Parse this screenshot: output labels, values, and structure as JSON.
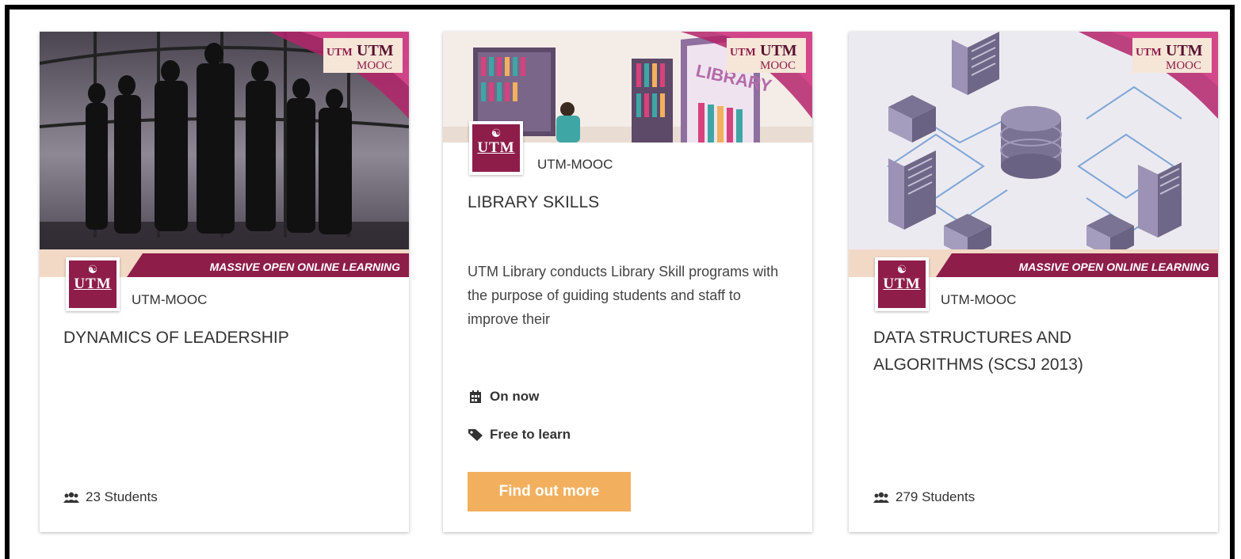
{
  "courses": [
    {
      "provider": "UTM-MOOC",
      "logo_text": "UTM",
      "banner": "MASSIVE OPEN ONLINE LEARNING",
      "brand": "UTM MOOC",
      "title": "DYNAMICS OF LEADERSHIP",
      "students": "23 Students",
      "icon": "users-icon"
    },
    {
      "provider": "UTM-MOOC",
      "logo_text": "UTM",
      "brand": "UTM MOOC",
      "hero_sign": "LIBRARY",
      "title": "LIBRARY SKILLS",
      "description": "UTM Library conducts Library Skill programs with the purpose of guiding students and staff to improve their",
      "availability": "On now",
      "price": "Free to learn",
      "button_label": "Find out more"
    },
    {
      "provider": "UTM-MOOC",
      "logo_text": "UTM",
      "banner": "MASSIVE OPEN ONLINE LEARNING",
      "brand": "UTM MOOC",
      "title": "DATA STRUCTURES AND ALGORITHMS (SCSJ 2013)",
      "students": "279 Students",
      "icon": "users-icon"
    }
  ],
  "colors": {
    "brand": "#8e1d4a",
    "accent": "#f2b05e",
    "magenta": "#b3246a"
  }
}
